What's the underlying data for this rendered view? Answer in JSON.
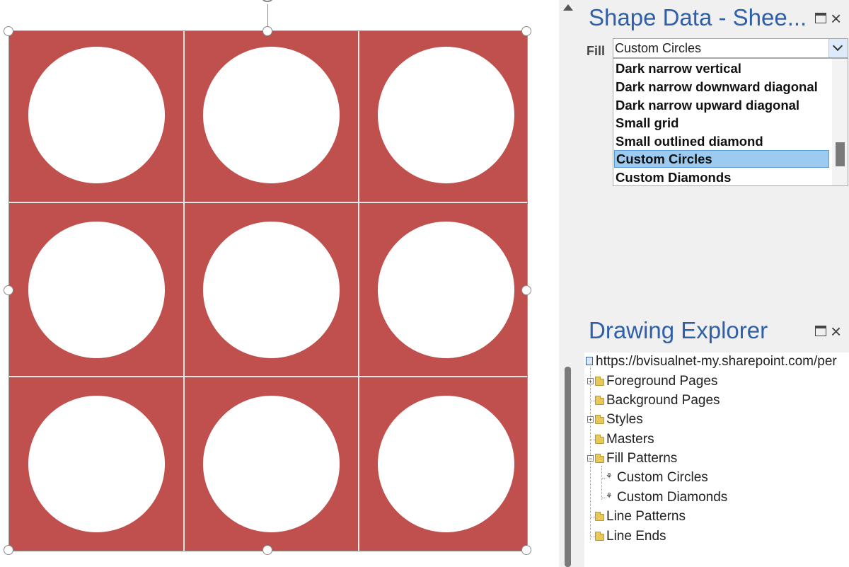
{
  "shape_data": {
    "title": "Shape Data - Shee...",
    "fill_label": "Fill",
    "fill_value": "Custom Circles",
    "fill_options": [
      "Dark narrow vertical",
      "Dark narrow downward diagonal",
      "Dark narrow upward diagonal",
      "Small grid",
      "Small outlined diamond",
      "Custom Circles",
      "Custom Diamonds"
    ],
    "selected_option": "Custom Circles"
  },
  "drawing_explorer": {
    "title": "Drawing Explorer",
    "root": "https://bvisualnet-my.sharepoint.com/per",
    "nodes": [
      "Foreground Pages",
      "Background Pages",
      "Styles",
      "Masters",
      "Fill Patterns",
      "Custom Circles",
      "Custom Diamonds",
      "Line Patterns",
      "Line Ends"
    ]
  },
  "colors": {
    "shape_fill": "#c0504d",
    "pattern_circle": "#ffffff",
    "panel_title": "#2e5fa8",
    "selection_highlight": "#9ccaf0"
  },
  "icons": {
    "close": "×",
    "expand": "+",
    "collapse": "−"
  }
}
